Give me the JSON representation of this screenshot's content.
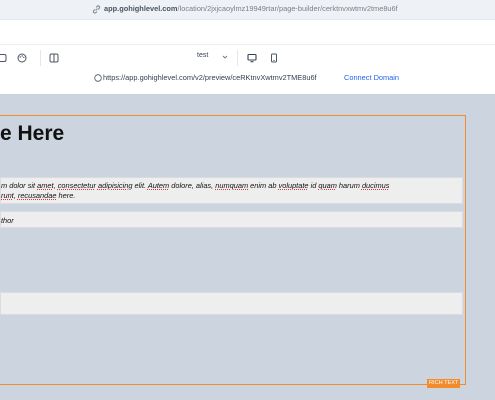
{
  "browser": {
    "url_host": "app.gohighlevel.com",
    "url_path": "/location/2jxjcaoylmz19949rtar/page-builder/cerktnvxwtmv2tme8u6f"
  },
  "toolbar": {
    "page_select": "test"
  },
  "preview": {
    "url": "https://app.gohighlevel.com/v2/preview/ceRKtnvXwtmv2TME8u6f",
    "connect_domain": "Connect Domain"
  },
  "canvas": {
    "heading": "e Here",
    "paragraph_line1_a": "m dolor sit ",
    "paragraph_line1_u1": "amet",
    "paragraph_line1_b": ", ",
    "paragraph_line1_u2": "consectetur",
    "paragraph_line1_c": " ",
    "paragraph_line1_u3": "adipisicing",
    "paragraph_line1_d": " elit. ",
    "paragraph_line1_u4": "Autem",
    "paragraph_line1_e": " dolore, alias, ",
    "paragraph_line1_u5": "numquam",
    "paragraph_line1_f": " enim ab ",
    "paragraph_line1_u6": "voluptate",
    "paragraph_line1_g": " id ",
    "paragraph_line1_u7": "quam",
    "paragraph_line1_h": " harum ",
    "paragraph_line1_u8": "ducimus",
    "paragraph_line2_u1": "runt",
    "paragraph_line2_a": ", ",
    "paragraph_line2_u2": "recusandae",
    "paragraph_line2_b": " here.",
    "author": "thor",
    "selected_element_tag": "RICH TEXT"
  },
  "colors": {
    "selection": "#f28b2c",
    "link": "#2563eb",
    "canvas_bg": "#ccd5df"
  }
}
